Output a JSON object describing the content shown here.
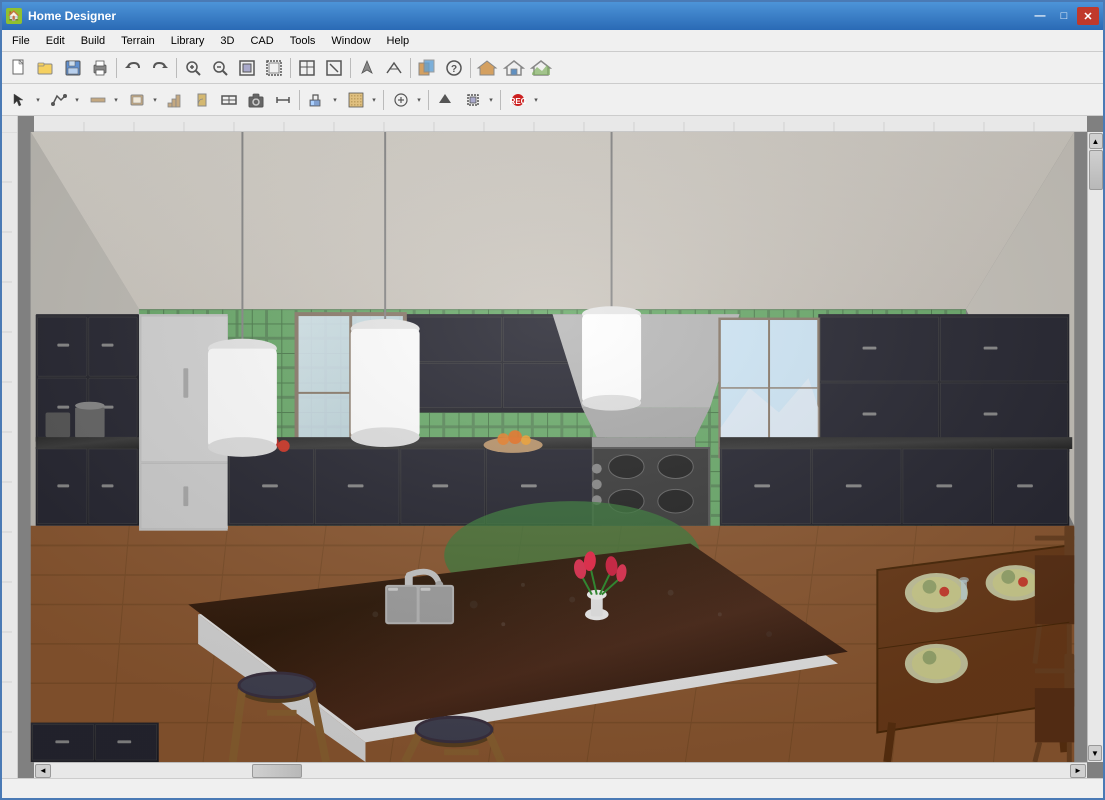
{
  "window": {
    "title": "Home Designer",
    "icon": "🏠"
  },
  "title_controls": {
    "minimize": "—",
    "maximize": "□",
    "close": "✕"
  },
  "menu": {
    "items": [
      "File",
      "Edit",
      "Build",
      "Terrain",
      "Library",
      "3D",
      "CAD",
      "Tools",
      "Window",
      "Help"
    ]
  },
  "toolbar1": {
    "buttons": [
      {
        "name": "new",
        "icon": "📄",
        "label": "New"
      },
      {
        "name": "open",
        "icon": "📂",
        "label": "Open"
      },
      {
        "name": "save",
        "icon": "💾",
        "label": "Save"
      },
      {
        "name": "print",
        "icon": "🖨",
        "label": "Print"
      },
      {
        "name": "sep1",
        "icon": "|",
        "label": ""
      },
      {
        "name": "undo",
        "icon": "↩",
        "label": "Undo"
      },
      {
        "name": "redo",
        "icon": "↪",
        "label": "Redo"
      },
      {
        "name": "sep2",
        "icon": "|",
        "label": ""
      },
      {
        "name": "zoom-in",
        "icon": "🔍",
        "label": "Zoom In"
      },
      {
        "name": "zoom-out",
        "icon": "🔍",
        "label": "Zoom Out"
      },
      {
        "name": "zoom-fit",
        "icon": "⊞",
        "label": "Zoom Fit"
      },
      {
        "name": "zoom-window",
        "icon": "⊟",
        "label": "Zoom Window"
      },
      {
        "name": "sep3",
        "icon": "|",
        "label": ""
      },
      {
        "name": "plan-view",
        "icon": "⊡",
        "label": "Plan View"
      },
      {
        "name": "section",
        "icon": "⊢",
        "label": "Section"
      },
      {
        "name": "sep4",
        "icon": "|",
        "label": ""
      },
      {
        "name": "materials",
        "icon": "🎨",
        "label": "Materials"
      },
      {
        "name": "help",
        "icon": "?",
        "label": "Help"
      },
      {
        "name": "sep5",
        "icon": "|",
        "label": ""
      },
      {
        "name": "house",
        "icon": "🏠",
        "label": "House"
      },
      {
        "name": "roof",
        "icon": "⌂",
        "label": "Roof"
      },
      {
        "name": "terrain",
        "icon": "⛰",
        "label": "Terrain"
      }
    ]
  },
  "toolbar2": {
    "buttons": [
      {
        "name": "select",
        "icon": "↖",
        "label": "Select"
      },
      {
        "name": "polyline",
        "icon": "⌒",
        "label": "Polyline"
      },
      {
        "name": "wall",
        "icon": "▬",
        "label": "Wall"
      },
      {
        "name": "room",
        "icon": "⬛",
        "label": "Room"
      },
      {
        "name": "stairs",
        "icon": "⊟",
        "label": "Stairs"
      },
      {
        "name": "door",
        "icon": "🚪",
        "label": "Door"
      },
      {
        "name": "window",
        "icon": "⬜",
        "label": "Window"
      },
      {
        "name": "camera",
        "icon": "📷",
        "label": "Camera"
      },
      {
        "name": "dimension",
        "icon": "↔",
        "label": "Dimension"
      },
      {
        "name": "sep1",
        "icon": "|",
        "label": ""
      },
      {
        "name": "paint",
        "icon": "🖌",
        "label": "Paint"
      },
      {
        "name": "fill",
        "icon": "🪣",
        "label": "Fill"
      },
      {
        "name": "sep2",
        "icon": "|",
        "label": ""
      },
      {
        "name": "symbol",
        "icon": "⊕",
        "label": "Symbol"
      },
      {
        "name": "sep3",
        "icon": "|",
        "label": ""
      },
      {
        "name": "arrow-up",
        "icon": "▲",
        "label": "Arrow Up"
      },
      {
        "name": "transform",
        "icon": "⊞",
        "label": "Transform"
      },
      {
        "name": "sep4",
        "icon": "|",
        "label": ""
      },
      {
        "name": "record",
        "icon": "⏺",
        "label": "Record"
      }
    ]
  },
  "scene": {
    "description": "3D kitchen interior view"
  },
  "status": {
    "text": ""
  }
}
